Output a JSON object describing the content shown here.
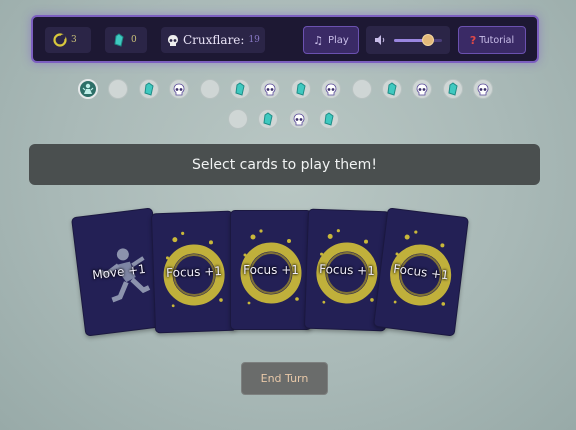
{
  "hud": {
    "moon_count": "3",
    "crystal_count": "0",
    "cruxflare_label": "Cruxflare:",
    "cruxflare_value": "19",
    "play_label": "Play",
    "volume_level": 0.7,
    "tutorial_label": "Tutorial"
  },
  "track": [
    {
      "type": "player",
      "icon": "spirit-icon"
    },
    {
      "type": "empty"
    },
    {
      "type": "crystal",
      "icon": "crystal-icon"
    },
    {
      "type": "skull",
      "icon": "skull-icon"
    },
    {
      "type": "empty"
    },
    {
      "type": "crystal",
      "icon": "crystal-icon"
    },
    {
      "type": "skull",
      "icon": "skull-icon"
    },
    {
      "type": "crystal",
      "icon": "crystal-icon"
    },
    {
      "type": "skull",
      "icon": "skull-icon"
    },
    {
      "type": "empty"
    },
    {
      "type": "crystal",
      "icon": "crystal-icon"
    },
    {
      "type": "skull",
      "icon": "skull-icon"
    },
    {
      "type": "crystal",
      "icon": "crystal-icon"
    },
    {
      "type": "skull",
      "icon": "skull-icon"
    },
    {
      "type": "empty"
    },
    {
      "type": "crystal",
      "icon": "crystal-icon"
    },
    {
      "type": "skull",
      "icon": "skull-icon"
    },
    {
      "type": "crystal",
      "icon": "crystal-icon"
    }
  ],
  "banner_text": "Select cards to play them!",
  "hand": [
    {
      "label": "Move +1",
      "art": "runner-art"
    },
    {
      "label": "Focus +1",
      "art": "moon-art"
    },
    {
      "label": "Focus +1",
      "art": "moon-art"
    },
    {
      "label": "Focus +1",
      "art": "moon-art"
    },
    {
      "label": "Focus +1",
      "art": "moon-art"
    }
  ],
  "end_turn_label": "End Turn",
  "colors": {
    "panel": "#1d1833",
    "panel_border": "#7c5fc0",
    "crystal": "#3fc9c0",
    "card_bg": "#232055",
    "moon_gold": "#c9b83a"
  }
}
